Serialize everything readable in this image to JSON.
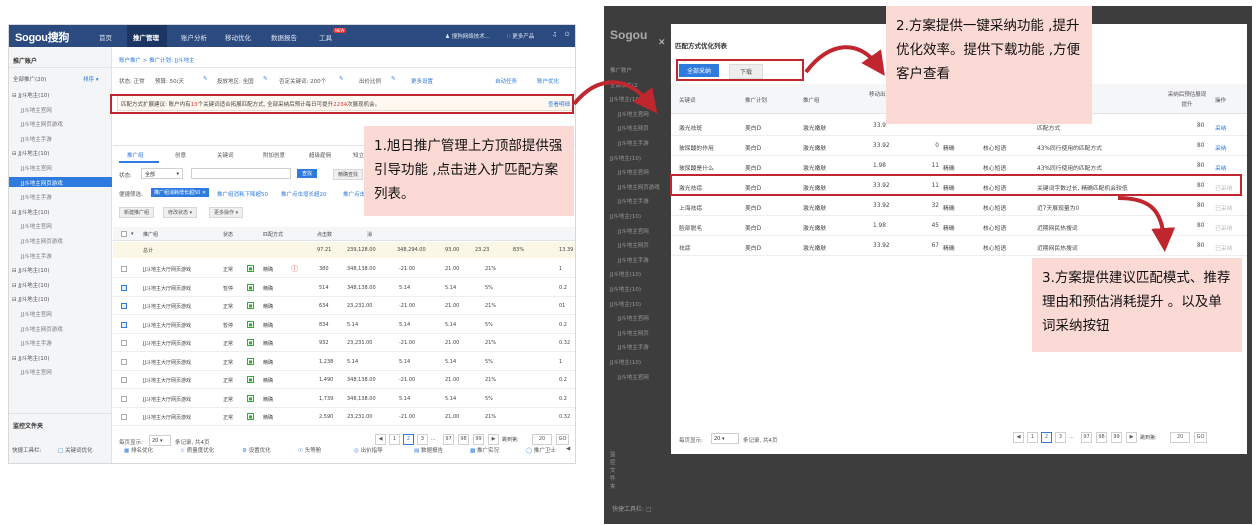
{
  "left": {
    "logo": "Sogou搜狗",
    "nav": [
      "首页",
      "推广管理",
      "账户分析",
      "移动优化",
      "数据报告",
      "工具"
    ],
    "new_badge": "NEW",
    "top_right": [
      "搜狗网络技术...",
      "更多产品"
    ],
    "sidebar": {
      "title": "推广账户",
      "all": "全部推广(20)",
      "sort": "排序",
      "items": [
        {
          "label": "JJ斗地主(10)",
          "type": "group"
        },
        {
          "label": "JJ斗地主官网",
          "type": "sub"
        },
        {
          "label": "JJ斗地主网页游戏",
          "type": "sub"
        },
        {
          "label": "JJ斗地主手游",
          "type": "sub"
        },
        {
          "label": "JJ斗地主(10)",
          "type": "group"
        },
        {
          "label": "JJ斗地主官网",
          "type": "sub"
        },
        {
          "label": "JJ斗地主网页游戏",
          "type": "selected"
        },
        {
          "label": "JJ斗地主手游",
          "type": "sub"
        },
        {
          "label": "JJ斗地主(10)",
          "type": "group"
        },
        {
          "label": "JJ斗地主官网",
          "type": "sub"
        },
        {
          "label": "JJ斗地主网页游戏",
          "type": "sub"
        },
        {
          "label": "JJ斗地主手游",
          "type": "sub"
        },
        {
          "label": "JJ斗地主(10)",
          "type": "group"
        },
        {
          "label": "JJ斗地主(10)",
          "type": "group"
        },
        {
          "label": "JJ斗地主(10)",
          "type": "group"
        },
        {
          "label": "JJ斗地主官网",
          "type": "sub"
        },
        {
          "label": "JJ斗地主网页游戏",
          "type": "sub"
        },
        {
          "label": "JJ斗地主手游",
          "type": "sub"
        },
        {
          "label": "JJ斗地主(10)",
          "type": "group"
        },
        {
          "label": "JJ斗地主官网",
          "type": "sub"
        }
      ],
      "monitor": "监控文件夹"
    },
    "breadcrumb": "账户推广 > 推广计划: JJ斗地主",
    "info_bar": [
      "状态: 正常",
      "预算: 50/天",
      "投放地区: 全国",
      "否定关键词: 200个",
      "出价比例",
      "更多设置",
      "自动任务",
      "账户优化"
    ],
    "suggestion": "匹配方式扩展建议: 账户内有13个关键词适合拓展匹配方式, 全部采纳后预计每日可提升2234次展现机会。",
    "suggestion_link": "查看明细",
    "tabs": [
      "推广组",
      "创意",
      "关键词",
      "附加创意",
      "超级雇佣",
      "知立方"
    ],
    "filter": {
      "status_label": "状态:",
      "status_value": "全部",
      "search_btn": "查找",
      "exact_btn": "精确查找"
    },
    "quick_filter": {
      "label": "便捷筛选:",
      "tag": "推广组消耗增长超50",
      "items": [
        "推广组消耗下降超50",
        "推广点击增长超20",
        "推广点击下"
      ]
    },
    "actions": [
      "新建推广组",
      "修改状态",
      "更多操作"
    ],
    "table_headers": [
      "推广组",
      "状态",
      "匹配方式",
      "点击数",
      "消"
    ],
    "total_row": {
      "label": "总计",
      "values": [
        "97.21",
        "239,128.00",
        "348,294.00",
        "93.00",
        "23.23",
        "83%",
        "13.39"
      ]
    },
    "rows": [
      {
        "name": "JJ斗地主大厅网页游戏",
        "status": "正常",
        "match": "精确",
        "checked": false,
        "vals": [
          "380",
          "348,138.00",
          "-21.00",
          "21.00",
          "21%",
          "1"
        ]
      },
      {
        "name": "JJ斗地主大厅网页游戏",
        "status": "暂停",
        "match": "精确",
        "checked": true,
        "vals": [
          "514",
          "348,138.00",
          "5.14",
          "5.14",
          "5%",
          "0.2"
        ]
      },
      {
        "name": "JJ斗地主大厅网页游戏",
        "status": "正常",
        "match": "精确",
        "checked": true,
        "vals": [
          "634",
          "23,231.00",
          "-21.00",
          "21.00",
          "21%",
          "01"
        ]
      },
      {
        "name": "JJ斗地主大厅网页游戏",
        "status": "暂停",
        "match": "精确",
        "checked": true,
        "vals": [
          "834",
          "5.14",
          "5.14",
          "5.14",
          "5%",
          "0.2"
        ]
      },
      {
        "name": "JJ斗地主大厅网页游戏",
        "status": "正常",
        "match": "精确",
        "checked": false,
        "vals": [
          "932",
          "23,231.00",
          "-21.00",
          "21.00",
          "21%",
          "0.32"
        ]
      },
      {
        "name": "JJ斗地主大厅网页游戏",
        "status": "正常",
        "match": "精确",
        "checked": false,
        "vals": [
          "1,238",
          "5.14",
          "5.14",
          "5.14",
          "5%",
          "1"
        ]
      },
      {
        "name": "JJ斗地主大厅网页游戏",
        "status": "正常",
        "match": "精确",
        "checked": false,
        "vals": [
          "1,490",
          "348,138.00",
          "-21.00",
          "21.00",
          "21%",
          "0.2"
        ]
      },
      {
        "name": "JJ斗地主大厅网页游戏",
        "status": "正常",
        "match": "精确",
        "checked": false,
        "vals": [
          "1,739",
          "348,138.00",
          "5.14",
          "5.14",
          "5%",
          "0.2"
        ]
      },
      {
        "name": "JJ斗地主大厅网页游戏",
        "status": "正常",
        "match": "精确",
        "checked": false,
        "vals": [
          "2,590",
          "23,231.00",
          "-21.00",
          "21.00",
          "21%",
          "0.32"
        ]
      }
    ],
    "pager": {
      "per_page_label": "每页显示:",
      "per_page": "20",
      "summary": "条记录, 共4页",
      "pages": [
        "1",
        "2",
        "3",
        "...",
        "97",
        "98",
        "99"
      ],
      "jump_label": "跳到第:",
      "jump_value": "20",
      "go": "GO"
    },
    "bottom_tools": [
      "快捷工具栏:",
      "关键词优化",
      "排名优化",
      "质量度优化",
      "设置优化",
      "头等舱",
      "出价指导",
      "数据报告",
      "推广实况",
      "推广卫士"
    ]
  },
  "right": {
    "modal_title": "匹配方式优化列表",
    "btn_accept_all": "全部采纳",
    "btn_download": "下载",
    "headers": [
      "关键词",
      "推广计划",
      "推广组",
      "移动出",
      "采纳后预估展现提升",
      "操作"
    ],
    "rows": [
      {
        "kw": "激光祛斑",
        "plan": "美白D",
        "group": "激光嫩肤",
        "v1": "33.9",
        "v2": "",
        "m": "",
        "reason": "",
        "desc": "匹配方式",
        "lift": "80",
        "act": "采纳",
        "enabled": true
      },
      {
        "kw": "玻尿酸的作用",
        "plan": "美白D",
        "group": "激光嫩肤",
        "v1": "33.92",
        "v2": "0",
        "m": "精确",
        "reason": "核心短语",
        "desc": "43%同行使用的匹配方式",
        "lift": "80",
        "act": "采纳",
        "enabled": true
      },
      {
        "kw": "玻尿酸是什么",
        "plan": "美白D",
        "group": "激光嫩肤",
        "v1": "1.98",
        "v2": "11",
        "m": "精确",
        "reason": "核心短语",
        "desc": "43%同行使用的匹配方式",
        "lift": "80",
        "act": "采纳",
        "enabled": true
      },
      {
        "kw": "激光祛痣",
        "plan": "美白D",
        "group": "激光嫩肤",
        "v1": "33.92",
        "v2": "11",
        "m": "精确",
        "reason": "核心短语",
        "desc": "关键词字数过长, 精确匹配机会较低",
        "lift": "80",
        "act": "已采纳",
        "enabled": false
      },
      {
        "kw": "上海祛痣",
        "plan": "美白D",
        "group": "激光嫩肤",
        "v1": "33.92",
        "v2": "32",
        "m": "精确",
        "reason": "核心短语",
        "desc": "近7天展现量为0",
        "lift": "80",
        "act": "已采纳",
        "enabled": false
      },
      {
        "kw": "脸部脱毛",
        "plan": "美白D",
        "group": "激光嫩肤",
        "v1": "1.98",
        "v2": "45",
        "m": "精确",
        "reason": "核心短语",
        "desc": "近期网民热搜词",
        "lift": "80",
        "act": "已采纳",
        "enabled": false
      },
      {
        "kw": "祛痣",
        "plan": "美白D",
        "group": "激光嫩肤",
        "v1": "33.92",
        "v2": "67",
        "m": "精确",
        "reason": "核心短语",
        "desc": "近期网民热搜词",
        "lift": "80",
        "act": "已采纳",
        "enabled": false
      }
    ],
    "pager": {
      "per_page_label": "每页显示:",
      "per_page": "20",
      "summary": "条记录, 共4页",
      "pages": [
        "1",
        "2",
        "3",
        "...",
        "97",
        "98",
        "99"
      ],
      "jump_label": "跳到第:",
      "jump_value": "20",
      "go": "GO"
    },
    "bg_sidebar": [
      "推广账户",
      "全部推广(2",
      "JJ斗地主(10)",
      "JJ斗地主官网",
      "JJ斗地主网页",
      "JJ斗地主手游",
      "JJ斗地主(10)",
      "JJ斗地主官网",
      "JJ斗地主网页游戏",
      "JJ斗地主手游",
      "JJ斗地主(10)",
      "JJ斗地主官网",
      "JJ斗地主网页",
      "JJ斗地主手游",
      "JJ斗地主(10)",
      "JJ斗地主(10)",
      "JJ斗地主(10)",
      "JJ斗地主官网",
      "JJ斗地主网页",
      "JJ斗地主手游",
      "JJ斗地主(10)",
      "JJ斗地主官网"
    ],
    "bg_monitor": "监控文件夹",
    "bg_tools": "快捷工具栏:"
  },
  "callouts": {
    "c1": "1.旭日推广管理上方顶部提供强引导功能 ,点击进入扩匹配方案列表。",
    "c2": "2.方案提供一键采纳功能 ,提升优化效率。提供下载功能 ,方便客户查看",
    "c3": "3.方案提供建议匹配模式、推荐理由和预估消耗提升 。以及单词采纳按钮"
  },
  "colors": {
    "nav": "#2b4a80",
    "accent": "#2e7be0",
    "callout": "#fbd9d5",
    "highlight": "#c0262d"
  }
}
